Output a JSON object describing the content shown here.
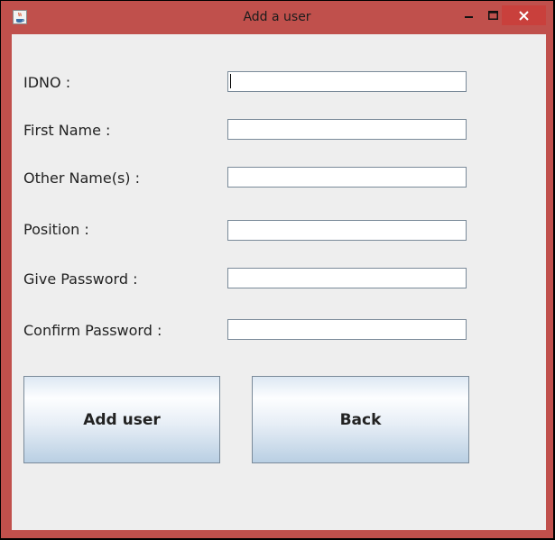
{
  "window": {
    "title": "Add a user",
    "controls": {
      "minimize": "–",
      "maximize": "□",
      "close": "✕"
    },
    "colors": {
      "frame": "#c0504c",
      "client": "#eeeeee",
      "close": "#c9403c"
    }
  },
  "form": {
    "fields": [
      {
        "label": "IDNO :",
        "value": ""
      },
      {
        "label": "First Name :",
        "value": ""
      },
      {
        "label": "Other Name(s) :",
        "value": ""
      },
      {
        "label": "Position :",
        "value": ""
      },
      {
        "label": "Give Password :",
        "value": ""
      },
      {
        "label": "Confirm Password :",
        "value": ""
      }
    ]
  },
  "buttons": {
    "add_label": "Add user",
    "back_label": "Back"
  }
}
